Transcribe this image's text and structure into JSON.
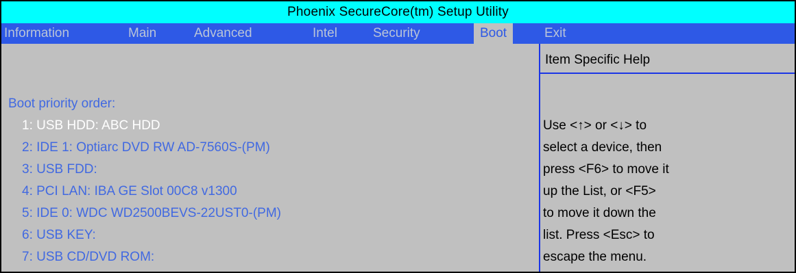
{
  "title": "Phoenix SecureCore(tm) Setup Utility",
  "menu": {
    "items": [
      {
        "label": "Information"
      },
      {
        "label": "Main"
      },
      {
        "label": "Advanced"
      },
      {
        "label": "Intel"
      },
      {
        "label": "Security"
      },
      {
        "label": "Boot"
      },
      {
        "label": "Exit"
      }
    ],
    "selected": "Boot"
  },
  "boot": {
    "heading": "Boot priority order:",
    "items": [
      {
        "label": "1: USB HDD: ABC HDD"
      },
      {
        "label": "2: IDE 1: Optiarc DVD RW AD-7560S-(PM)"
      },
      {
        "label": "3: USB FDD:"
      },
      {
        "label": "4: PCI LAN: IBA GE Slot 00C8 v1300"
      },
      {
        "label": "5: IDE 0: WDC WD2500BEVS-22UST0-(PM)"
      },
      {
        "label": "6: USB KEY:"
      },
      {
        "label": "7: USB CD/DVD ROM:"
      }
    ],
    "highlighted_index": 0
  },
  "help": {
    "title": "Item Specific Help",
    "lines": [
      "Use <↑> or <↓> to",
      "select a device, then",
      "press <F6> to move it",
      "up the List, or <F5>",
      "to move it down the",
      "list. Press <Esc> to",
      "escape the menu."
    ]
  },
  "colors": {
    "title_bar_bg": "#00ffff",
    "menu_bar_bg": "#2e59e6",
    "body_bg": "#c0c0c0",
    "item_text": "#4169e1",
    "highlight_text": "#ffffff",
    "help_text": "#000000"
  }
}
